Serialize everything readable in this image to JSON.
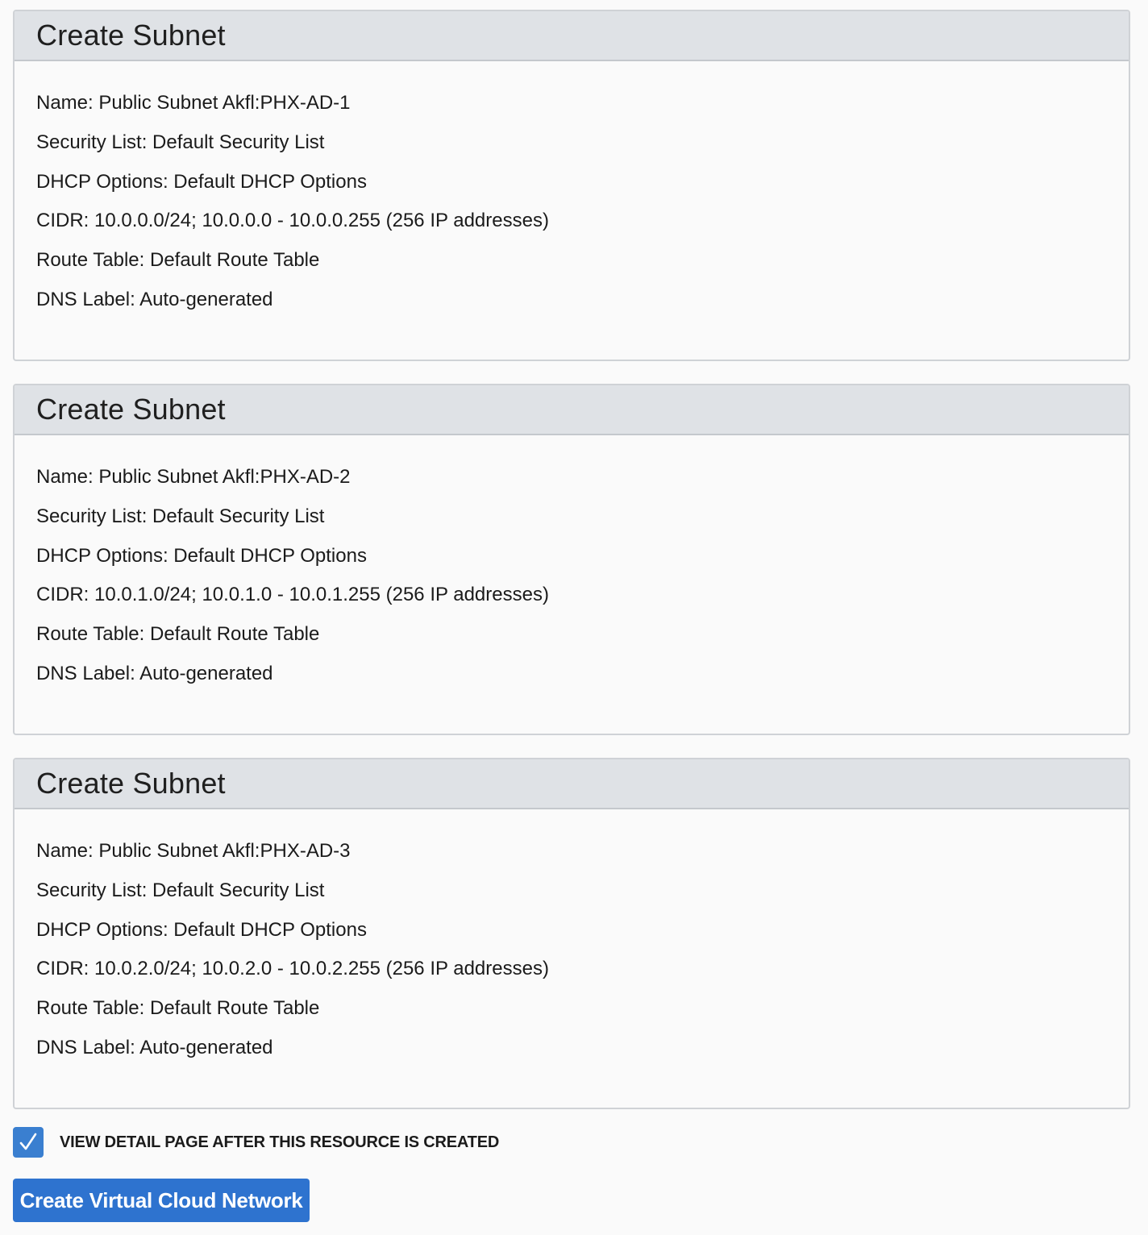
{
  "subnets": [
    {
      "title": "Create Subnet",
      "name": "Name: Public Subnet Akfl:PHX-AD-1",
      "security_list": "Security List: Default Security List",
      "dhcp_options": "DHCP Options: Default DHCP Options",
      "cidr": "CIDR: 10.0.0.0/24; 10.0.0.0 - 10.0.0.255 (256 IP addresses)",
      "route_table": "Route Table: Default Route Table",
      "dns_label": "DNS Label: Auto-generated"
    },
    {
      "title": "Create Subnet",
      "name": "Name: Public Subnet Akfl:PHX-AD-2",
      "security_list": "Security List: Default Security List",
      "dhcp_options": "DHCP Options: Default DHCP Options",
      "cidr": "CIDR: 10.0.1.0/24; 10.0.1.0 - 10.0.1.255 (256 IP addresses)",
      "route_table": "Route Table: Default Route Table",
      "dns_label": "DNS Label: Auto-generated"
    },
    {
      "title": "Create Subnet",
      "name": "Name: Public Subnet Akfl:PHX-AD-3",
      "security_list": "Security List: Default Security List",
      "dhcp_options": "DHCP Options: Default DHCP Options",
      "cidr": "CIDR: 10.0.2.0/24; 10.0.2.0 - 10.0.2.255 (256 IP addresses)",
      "route_table": "Route Table: Default Route Table",
      "dns_label": "DNS Label: Auto-generated"
    }
  ],
  "view_detail_checkbox": {
    "label": "VIEW DETAIL PAGE AFTER THIS RESOURCE IS CREATED",
    "checked": true,
    "icon": "checkmark-icon"
  },
  "submit_button": {
    "label": "Create Virtual Cloud Network"
  },
  "colors": {
    "accent": "#2e73cf",
    "panel_header": "#dfe2e6",
    "background": "#fafafa"
  }
}
